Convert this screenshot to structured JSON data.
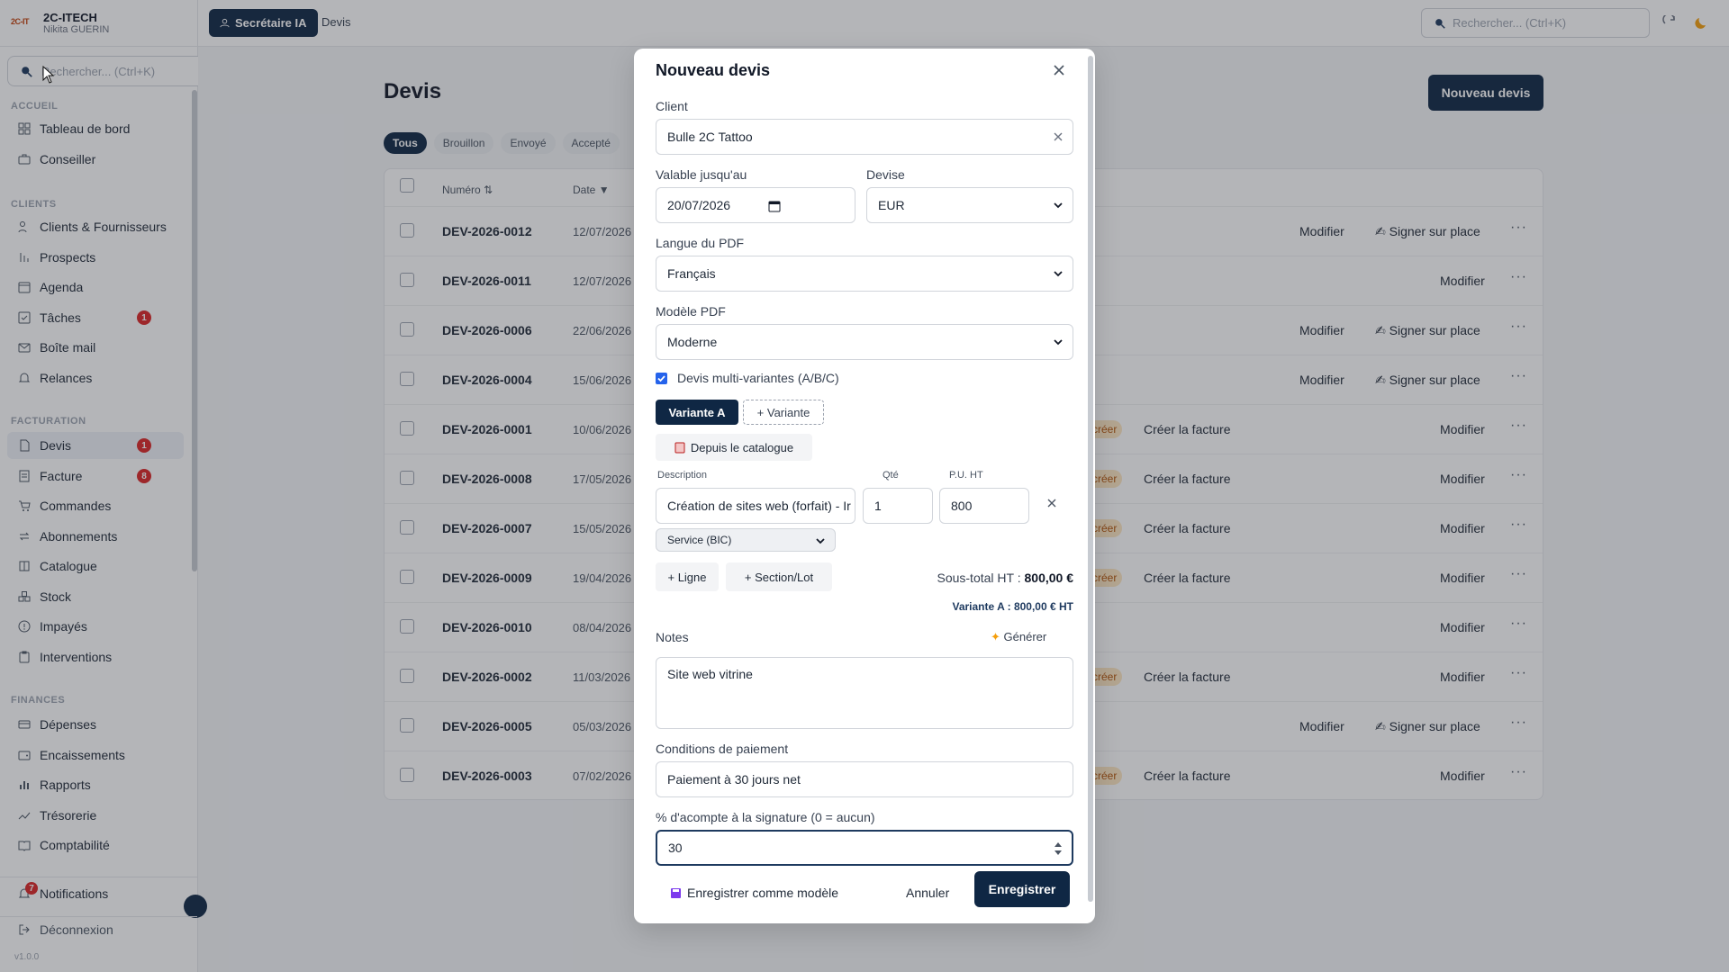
{
  "brand": {
    "name": "2C-ITECH",
    "user": "Nikita GUERIN",
    "logo_text": "2C-IT"
  },
  "sidebar": {
    "search_placeholder": "Rechercher... (Ctrl+K)",
    "sections": [
      {
        "title": "ACCUEIL",
        "items": [
          {
            "label": "Tableau de bord",
            "icon": "dashboard-icon"
          },
          {
            "label": "Conseiller",
            "icon": "briefcase-icon"
          }
        ]
      },
      {
        "title": "CLIENTS",
        "items": [
          {
            "label": "Clients & Fournisseurs",
            "icon": "users-icon"
          },
          {
            "label": "Prospects",
            "icon": "funnel-icon"
          },
          {
            "label": "Agenda",
            "icon": "calendar-icon"
          },
          {
            "label": "Tâches",
            "icon": "checkbox-icon",
            "badge": "1"
          },
          {
            "label": "Boîte mail",
            "icon": "mail-icon"
          },
          {
            "label": "Relances",
            "icon": "bell-icon"
          }
        ]
      },
      {
        "title": "FACTURATION",
        "items": [
          {
            "label": "Devis",
            "icon": "document-icon",
            "badge": "1",
            "active": true
          },
          {
            "label": "Facture",
            "icon": "invoice-icon",
            "badge": "8"
          },
          {
            "label": "Commandes",
            "icon": "cart-icon"
          },
          {
            "label": "Abonnements",
            "icon": "repeat-icon"
          },
          {
            "label": "Catalogue",
            "icon": "book-icon"
          },
          {
            "label": "Stock",
            "icon": "boxes-icon"
          },
          {
            "label": "Impayés",
            "icon": "alert-icon"
          },
          {
            "label": "Interventions",
            "icon": "clipboard-icon"
          }
        ]
      },
      {
        "title": "FINANCES",
        "items": [
          {
            "label": "Dépenses",
            "icon": "card-icon"
          },
          {
            "label": "Encaissements",
            "icon": "wallet-icon"
          },
          {
            "label": "Rapports",
            "icon": "bar-chart-icon"
          },
          {
            "label": "Trésorerie",
            "icon": "trend-icon"
          },
          {
            "label": "Comptabilité",
            "icon": "ledger-icon"
          }
        ]
      }
    ],
    "notifications": {
      "label": "Notifications",
      "badge": "7"
    },
    "logout": "Déconnexion",
    "version": "v1.0.0"
  },
  "topbar": {
    "assistant_label": "Secrétaire IA",
    "link": "Devis",
    "search_placeholder": "Rechercher... (Ctrl+K)"
  },
  "page": {
    "title": "Devis",
    "new_button": "Nouveau devis",
    "filters": [
      "Tous",
      "Brouillon",
      "Envoyé",
      "Accepté"
    ],
    "columns": {
      "number": "Numéro",
      "date": "Date"
    },
    "rows": [
      {
        "num": "DEV-2026-0012",
        "date": "12/07/2026",
        "facture": "",
        "pill": "",
        "modif": "Modifier",
        "sign": "Signer sur place"
      },
      {
        "num": "DEV-2026-0011",
        "date": "12/07/2026",
        "facture": "",
        "pill": "",
        "modif": "Modifier",
        "sign": ""
      },
      {
        "num": "DEV-2026-0006",
        "date": "22/06/2026",
        "facture": "",
        "pill": "",
        "modif": "Modifier",
        "sign": "Signer sur place"
      },
      {
        "num": "DEV-2026-0004",
        "date": "15/06/2026",
        "facture": "",
        "pill": "",
        "modif": "Modifier",
        "sign": "Signer sur place"
      },
      {
        "num": "DEV-2026-0001",
        "date": "10/06/2026",
        "facture": "Créer la facture",
        "pill": "créer",
        "modif": "Modifier",
        "sign": ""
      },
      {
        "num": "DEV-2026-0008",
        "date": "17/05/2026",
        "facture": "Créer la facture",
        "pill": "créer",
        "modif": "Modifier",
        "sign": ""
      },
      {
        "num": "DEV-2026-0007",
        "date": "15/05/2026",
        "facture": "Créer la facture",
        "pill": "créer",
        "modif": "Modifier",
        "sign": ""
      },
      {
        "num": "DEV-2026-0009",
        "date": "19/04/2026",
        "facture": "Créer la facture",
        "pill": "créer",
        "modif": "Modifier",
        "sign": ""
      },
      {
        "num": "DEV-2026-0010",
        "date": "08/04/2026",
        "facture": "",
        "pill": "",
        "modif": "Modifier",
        "sign": ""
      },
      {
        "num": "DEV-2026-0002",
        "date": "11/03/2026",
        "facture": "Créer la facture",
        "pill": "créer",
        "modif": "Modifier",
        "sign": ""
      },
      {
        "num": "DEV-2026-0005",
        "date": "05/03/2026",
        "facture": "",
        "pill": "",
        "modif": "Modifier",
        "sign": "Signer sur place"
      },
      {
        "num": "DEV-2026-0003",
        "date": "07/02/2026",
        "facture": "Créer la facture",
        "pill": "créer",
        "modif": "Modifier",
        "sign": ""
      }
    ]
  },
  "modal": {
    "title": "Nouveau devis",
    "client_label": "Client",
    "client_value": "Bulle 2C Tattoo",
    "valid_label": "Valable jusqu'au",
    "valid_value": "20/07/2026",
    "currency_label": "Devise",
    "currency_value": "EUR",
    "lang_label": "Langue du PDF",
    "lang_value": "Français",
    "model_label": "Modèle PDF",
    "model_value": "Moderne",
    "multi_label": "Devis multi-variantes (A/B/C)",
    "multi_checked": true,
    "variant_a": "Variante A",
    "variant_add": "+ Variante",
    "catalog_btn": "Depuis le catalogue",
    "col_desc": "Description",
    "col_qty": "Qté",
    "col_pu": "P.U. HT",
    "line_desc": "Création de sites web (forfait) - Ir",
    "line_qty": "1",
    "line_pu": "800",
    "line_type": "Service (BIC)",
    "add_line": "+ Ligne",
    "add_section": "+ Section/Lot",
    "subtotal_label": "Sous-total HT :",
    "subtotal_value": "800,00 €",
    "variant_total": "Variante A : 800,00 € HT",
    "notes_label": "Notes",
    "generate_btn": "Générer",
    "notes_value": "Site web vitrine",
    "payment_label": "Conditions de paiement",
    "payment_value": "Paiement à 30 jours net",
    "deposit_label": "% d'acompte à la signature (0 = aucun)",
    "deposit_value": "30",
    "save_model": "Enregistrer comme modèle",
    "cancel": "Annuler",
    "save": "Enregistrer"
  },
  "colors": {
    "primary": "#0f2744",
    "badge": "#dc2626",
    "pill_bg": "#fde7c2",
    "pill_text": "#b45309"
  }
}
